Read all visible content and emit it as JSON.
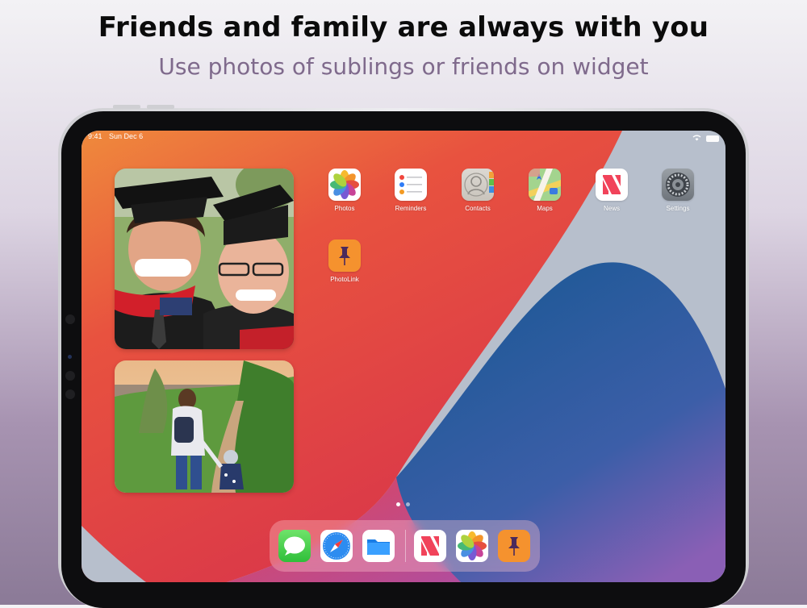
{
  "header": {
    "title": "Friends and family are always with you",
    "subtitle": "Use photos of sublings or friends on widget"
  },
  "status_bar": {
    "time": "9:41",
    "date": "Sun Dec 6"
  },
  "home_apps": [
    {
      "label": "Photos",
      "icon": "photos-icon"
    },
    {
      "label": "Reminders",
      "icon": "reminders-icon"
    },
    {
      "label": "Contacts",
      "icon": "contacts-icon"
    },
    {
      "label": "Maps",
      "icon": "maps-icon"
    },
    {
      "label": "News",
      "icon": "news-icon"
    },
    {
      "label": "Settings",
      "icon": "settings-icon"
    },
    {
      "label": "PhotoLink",
      "icon": "photolink-icon"
    }
  ],
  "widgets": [
    {
      "name": "photo-widget-graduates",
      "content": "two graduates in caps"
    },
    {
      "name": "photo-widget-family-walk",
      "content": "mother and child on path"
    }
  ],
  "page_indicator": {
    "pages": 2,
    "current": 1
  },
  "dock": [
    {
      "icon": "messages-icon"
    },
    {
      "icon": "safari-icon"
    },
    {
      "icon": "files-icon"
    },
    {
      "icon": "news-icon"
    },
    {
      "icon": "photos-icon"
    },
    {
      "icon": "photolink-icon"
    }
  ],
  "colors": {
    "wallpaper_red": "#e8483f",
    "wallpaper_orange": "#ee8a3a",
    "wallpaper_blue": "#2f5ba3",
    "photolink_orange": "#f5922e",
    "subtitle": "#7f6a8c"
  }
}
